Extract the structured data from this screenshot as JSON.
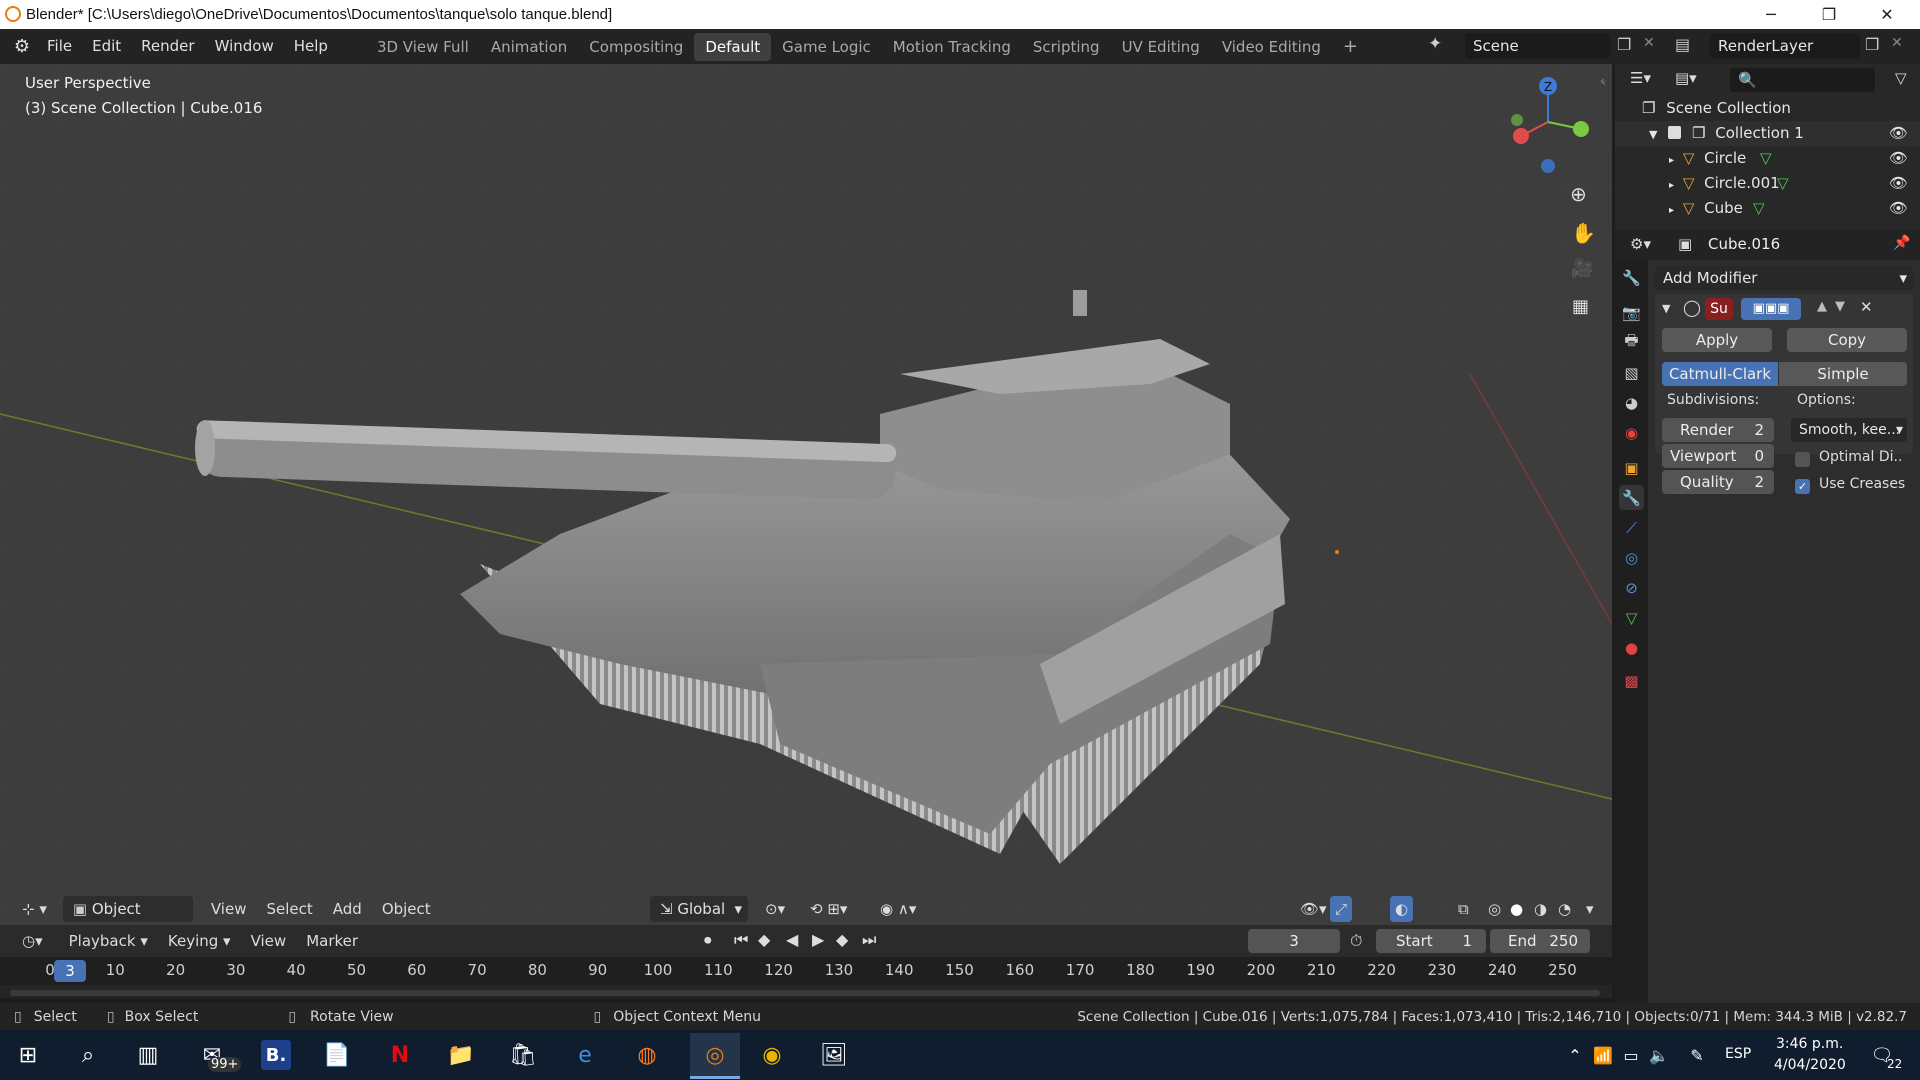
{
  "window": {
    "title": "Blender* [C:\\Users\\diego\\OneDrive\\Documentos\\Documentos\\tanque\\solo tanque.blend]",
    "minimize": "─",
    "maximize": "❐",
    "close": "✕"
  },
  "menus": [
    "File",
    "Edit",
    "Render",
    "Window",
    "Help"
  ],
  "workspaces": [
    {
      "label": "3D View Full",
      "active": false
    },
    {
      "label": "Animation",
      "active": false
    },
    {
      "label": "Compositing",
      "active": false
    },
    {
      "label": "Default",
      "active": true
    },
    {
      "label": "Game Logic",
      "active": false
    },
    {
      "label": "Motion Tracking",
      "active": false
    },
    {
      "label": "Scripting",
      "active": false
    },
    {
      "label": "UV Editing",
      "active": false
    },
    {
      "label": "Video Editing",
      "active": false
    }
  ],
  "add_workspace": "+",
  "scene": {
    "value": "Scene"
  },
  "render_layer": {
    "value": "RenderLayer"
  },
  "viewport": {
    "perspective": "User Perspective",
    "collection_info": "(3) Scene Collection | Cube.016",
    "gizmo_z": "Z",
    "header": {
      "mode": "Object Mode",
      "view": "View",
      "select": "Select",
      "add": "Add",
      "object": "Object",
      "orientation": "Global"
    }
  },
  "outliner": {
    "search_placeholder": "",
    "scene_collection": "Scene Collection",
    "collection": "Collection 1",
    "items": [
      {
        "name": "Circle"
      },
      {
        "name": "Circle.001"
      },
      {
        "name": "Cube"
      }
    ]
  },
  "properties": {
    "object_name": "Cube.016",
    "add_modifier": "Add Modifier",
    "modifier_name": "Su",
    "apply": "Apply",
    "copy": "Copy",
    "catmull": "Catmull-Clark",
    "simple": "Simple",
    "subdivisions_label": "Subdivisions:",
    "options_label": "Options:",
    "render_label": "Render",
    "render_value": "2",
    "viewport_label": "Viewport",
    "viewport_value": "0",
    "quality_label": "Quality",
    "quality_value": "2",
    "uv_smooth": "Smooth, kee...",
    "optimal_display": "Optimal Di..",
    "optimal_display_checked": false,
    "use_creases": "Use Creases",
    "use_creases_checked": true
  },
  "timeline": {
    "playback": "Playback",
    "keying": "Keying",
    "view": "View",
    "marker": "Marker",
    "current_frame": "3",
    "start_label": "Start",
    "start_value": "1",
    "end_label": "End",
    "end_value": "250",
    "ruler_current": "3",
    "ruler_ticks": [
      "0",
      "10",
      "20",
      "30",
      "40",
      "50",
      "60",
      "70",
      "80",
      "90",
      "100",
      "110",
      "120",
      "130",
      "140",
      "150",
      "160",
      "170",
      "180",
      "190",
      "200",
      "210",
      "220",
      "230",
      "240",
      "250"
    ]
  },
  "statusbar": {
    "select": "Select",
    "box_select": "Box Select",
    "rotate_view": "Rotate View",
    "context_menu": "Object Context Menu",
    "stats": "Scene Collection | Cube.016 | Verts:1,075,784 | Faces:1,073,410 | Tris:2,146,710 | Objects:0/71 | Mem: 344.3 MiB | v2.82.7"
  },
  "taskbar": {
    "mail_badge": "99+",
    "b_app": "B.",
    "language": "ESP",
    "time": "3:46 p.m.",
    "date": "4/04/2020",
    "notifications": "22"
  },
  "colors": {
    "accent": "#4772b3",
    "viewport_bg": "#3d3d3d",
    "header_bg": "#232323",
    "taskbar_bg": "#0f1d2e"
  }
}
